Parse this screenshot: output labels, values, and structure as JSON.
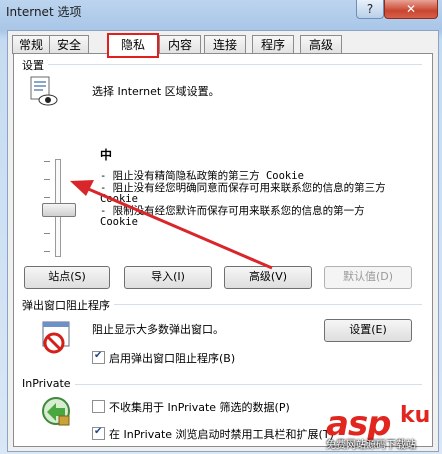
{
  "window": {
    "title": "Internet 选项",
    "help_glyph": "?",
    "close_glyph": "✕"
  },
  "tabs": [
    {
      "label": "常规"
    },
    {
      "label": "安全"
    },
    {
      "label": "隐私",
      "active": true
    },
    {
      "label": "内容"
    },
    {
      "label": "连接"
    },
    {
      "label": "程序"
    },
    {
      "label": "高级"
    }
  ],
  "settings": {
    "group_title": "设置",
    "instruction": "选择 Internet 区域设置。",
    "level_name": "中",
    "level_lines": [
      "- 阻止没有精简隐私政策的第三方 Cookie",
      "- 阻止没有经您明确同意而保存可用来联系您的信息的第三方 Cookie",
      "- 限制没有经您默许而保存可用来联系您的信息的第一方 Cookie"
    ],
    "buttons": {
      "sites": "站点(S)",
      "import": "导入(I)",
      "advanced": "高级(V)",
      "default": "默认值(D)"
    }
  },
  "popup": {
    "group_title": "弹出窗口阻止程序",
    "description": "阻止显示大多数弹出窗口。",
    "settings_button": "设置(E)",
    "enable_label": "启用弹出窗口阻止程序(B)",
    "enable_checked": true
  },
  "inprivate": {
    "group_title": "InPrivate",
    "no_collect_label": "不收集用于 InPrivate 筛选的数据(P)",
    "no_collect_checked": false,
    "disable_label": "在 InPrivate 浏览启动时禁用工具栏和扩展(T)",
    "disable_checked": true
  },
  "watermark": {
    "brand": "asp",
    "brand_ku": "ku",
    "site": "免费网站源码下载站"
  },
  "colors": {
    "highlight_red": "#e0201c",
    "arrow": "#d9262a"
  }
}
